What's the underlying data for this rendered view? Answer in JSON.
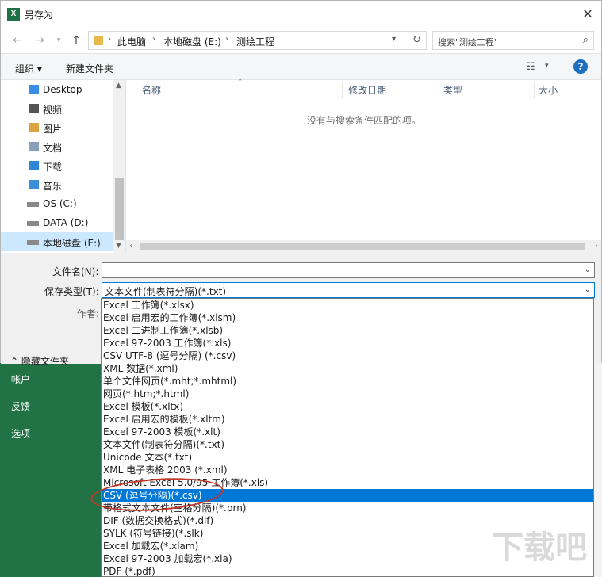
{
  "window": {
    "title": "另存为",
    "app_icon": "X"
  },
  "navigation": {
    "breadcrumb": [
      "此电脑",
      "本地磁盘 (E:)",
      "测绘工程"
    ],
    "search_placeholder": "搜索\"测绘工程\""
  },
  "toolbar": {
    "organize": "组织 ▾",
    "new_folder": "新建文件夹"
  },
  "tree": [
    {
      "label": "Desktop",
      "icon": "desktop-icon"
    },
    {
      "label": "视频",
      "icon": "video-icon"
    },
    {
      "label": "图片",
      "icon": "pictures-icon"
    },
    {
      "label": "文档",
      "icon": "documents-icon"
    },
    {
      "label": "下载",
      "icon": "download-icon"
    },
    {
      "label": "音乐",
      "icon": "music-icon"
    },
    {
      "label": "OS (C:)",
      "icon": "drive-icon"
    },
    {
      "label": "DATA (D:)",
      "icon": "drive-icon"
    },
    {
      "label": "本地磁盘 (E:)",
      "icon": "drive-icon",
      "selected": true
    }
  ],
  "columns": [
    "名称",
    "修改日期",
    "类型",
    "大小"
  ],
  "empty_message": "没有与搜索条件匹配的项。",
  "form": {
    "filename_label": "文件名(N):",
    "filename_value": "",
    "filetype_label": "保存类型(T):",
    "filetype_value": "文本文件(制表符分隔)(*.txt)",
    "author_label": "作者:",
    "hide_folders": "隐藏文件夹"
  },
  "filetype_options": [
    "Excel 工作簿(*.xlsx)",
    "Excel 启用宏的工作簿(*.xlsm)",
    "Excel 二进制工作簿(*.xlsb)",
    "Excel 97-2003 工作簿(*.xls)",
    "CSV UTF-8 (逗号分隔) (*.csv)",
    "XML 数据(*.xml)",
    "单个文件网页(*.mht;*.mhtml)",
    "网页(*.htm;*.html)",
    "Excel 模板(*.xltx)",
    "Excel 启用宏的模板(*.xltm)",
    "Excel 97-2003 模板(*.xlt)",
    "文本文件(制表符分隔)(*.txt)",
    "Unicode 文本(*.txt)",
    "XML 电子表格 2003 (*.xml)",
    "Microsoft Excel 5.0/95 工作簿(*.xls)",
    "CSV (逗号分隔)(*.csv)",
    "带格式文本文件(空格分隔)(*.prn)",
    "DIF (数据交换格式)(*.dif)",
    "SYLK (符号链接)(*.slk)",
    "Excel 加载宏(*.xlam)",
    "Excel 97-2003 加载宏(*.xla)",
    "PDF (*.pdf)"
  ],
  "selected_option_index": 15,
  "background_menu": [
    "帐户",
    "反馈",
    "选项"
  ],
  "watermark": "下载吧",
  "colors": {
    "accent": "#0078d7",
    "excel_green": "#217346",
    "annotation": "#c0392b"
  }
}
